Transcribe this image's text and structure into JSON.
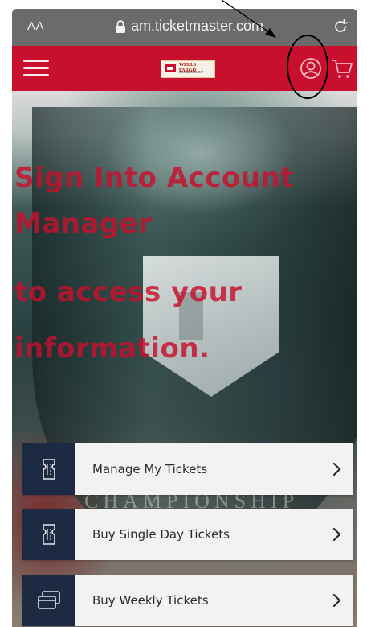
{
  "browser": {
    "text_size_label": "AA",
    "url": "am.ticketmaster.com"
  },
  "header": {
    "brand_name": "WELLS FARGO",
    "brand_subtitle": "CHAMPIONSHIP",
    "icons": [
      "menu-icon",
      "account-icon",
      "cart-icon"
    ]
  },
  "hero": {
    "title_lines": [
      "Sign Into Account",
      "Manager"
    ],
    "subtitle_lines": [
      "to access your",
      "information."
    ],
    "engraving": "CHAMPIONSHIP"
  },
  "menu": {
    "items": [
      {
        "label": "Manage My Tickets",
        "icon": "ticket-icon"
      },
      {
        "label": "Buy Single Day Tickets",
        "icon": "ticket-icon"
      },
      {
        "label": "Buy Weekly Tickets",
        "icon": "cards-icon"
      }
    ]
  },
  "colors": {
    "header_red": "#c8102e",
    "browser_gray": "#6b6b6b",
    "card_navy": "#1c2a44",
    "card_bg": "#f2f2f2"
  }
}
